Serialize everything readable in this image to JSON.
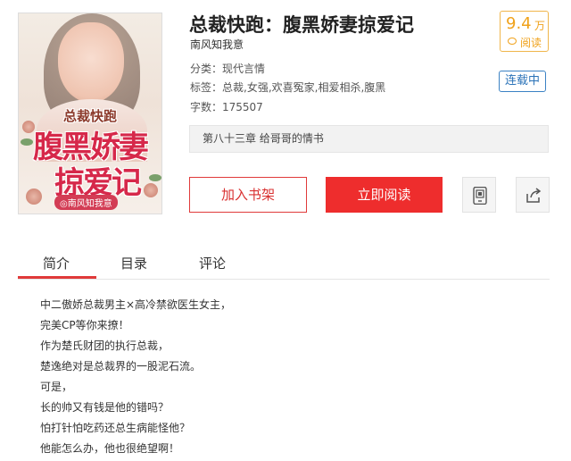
{
  "book": {
    "title": "总裁快跑：腹黑娇妻掠爱记",
    "author": "南风知我意",
    "category": "分类：现代言情",
    "tags": "标签：总裁,女强,欢喜冤家,相爱相杀,腹黑",
    "word_count": "字数：175507",
    "status": "连载中",
    "latest_chapter": "第八十三章 给哥哥的情书"
  },
  "cover": {
    "line1": "总裁快跑",
    "line2": "腹黑娇妻",
    "line3": "掠爱记",
    "author_tag": "◎南风知我意"
  },
  "score": {
    "value": "9.4",
    "unit": "万",
    "label": "阅读"
  },
  "actions": {
    "add_shelf": "加入书架",
    "read_now": "立即阅读",
    "mobile_icon": "mobile-qr-icon",
    "share_icon": "share-icon"
  },
  "tabs": [
    {
      "label": "简介"
    },
    {
      "label": "目录"
    },
    {
      "label": "评论"
    }
  ],
  "intro_lines": [
    "中二傲娇总裁男主×高冷禁欲医生女主，",
    "完美CP等你来撩！",
    "作为楚氏财团的执行总裁，",
    "楚逸绝对是总裁界的一股泥石流。",
    "可是，",
    "长的帅又有钱是他的错吗？",
    "怕打针怕吃药还总生病能怪他？",
    "他能怎么办，他也很绝望啊！"
  ],
  "colors": {
    "accent_red": "#ee2d2d",
    "score_orange": "#f0a21b",
    "status_blue": "#2b73b8"
  }
}
